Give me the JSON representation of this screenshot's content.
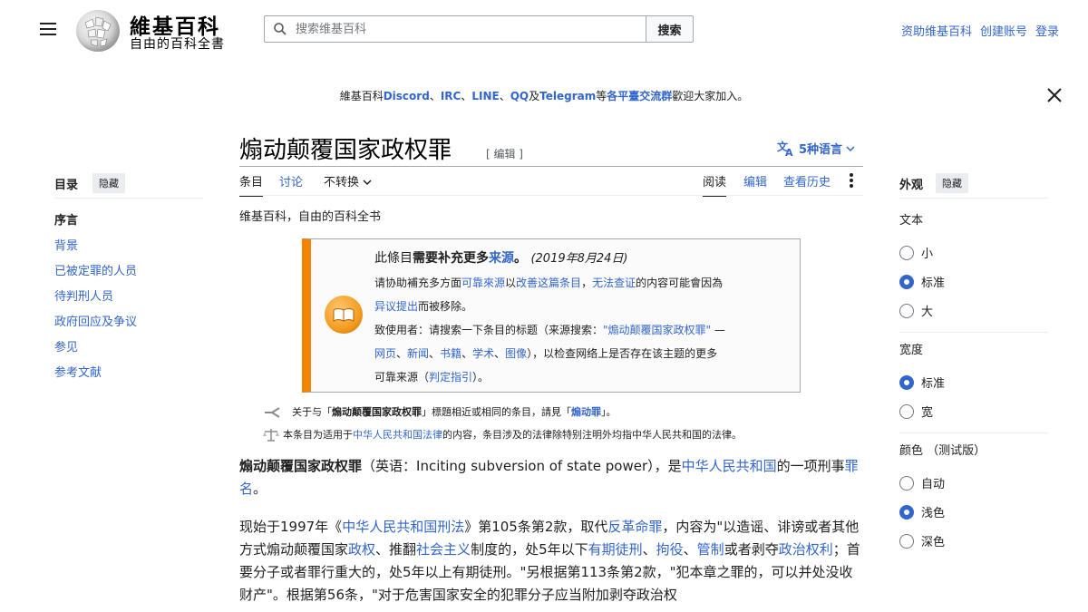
{
  "header": {
    "site_name": "維基百科",
    "tagline": "自由的百科全書",
    "search_placeholder": "搜索维基百科",
    "search_button": "搜索",
    "user_links": [
      "资助维基百科",
      "创建账号",
      "登录"
    ]
  },
  "notice": {
    "prefix": "維基百科",
    "discord": "Discord",
    "sep1": "、",
    "irc": "IRC",
    "sep2": "、",
    "line": "LINE",
    "sep3": "、",
    "qq": "QQ",
    "and": "及",
    "telegram": "Telegram",
    "mid": "等",
    "platforms": "各平臺交流群",
    "suffix": "歡迎大家加入。"
  },
  "article": {
    "title": "煽动颠覆国家政权罪",
    "edit_label": "[ 编辑 ]",
    "languages": "5种语言",
    "tabs_left": [
      "条目",
      "讨论",
      "不转换"
    ],
    "tabs_right": [
      "阅读",
      "编辑",
      "查看历史"
    ],
    "from": "维基百科，自由的百科全书"
  },
  "toc": {
    "heading": "目录",
    "hide": "隐藏",
    "items": [
      "序言",
      "背景",
      "已被定罪的人员",
      "待判刑人员",
      "政府回应及争议",
      "参见",
      "参考文献"
    ]
  },
  "ambox": {
    "l1a": "此條目",
    "l1b": "需要补充更多",
    "l1c": "来源",
    "l1d": "。",
    "l1date": "(2019年8月24日)",
    "l2a": "请协助補充多方面",
    "l2b": "可靠來源",
    "l2c": "以",
    "l2d": "改善这篇条目",
    "l2e": "，",
    "l2f": "无法查证",
    "l2g": "的内容可能會因為",
    "l3a": "异议提出",
    "l3b": "而被移除。",
    "l4a": "致使用者：请搜索一下条目的标题（来源搜索：",
    "l4b": "\"煽动颠覆国家政权罪\"",
    "l4c": " —",
    "l5links": [
      "网页",
      "新闻",
      "书籍",
      "学术",
      "图像"
    ],
    "l5sep": "、",
    "l5b": "），以检查网络上是否存在该主题的更多",
    "l6a": "可靠来源（",
    "l6b": "判定指引",
    "l6c": "）。"
  },
  "hatnotes": {
    "h1a": "关于与「",
    "h1b": "煽动颠覆国家政权罪",
    "h1c": "」標題相近或相同的条目，請見「",
    "h1d": "煽动罪",
    "h1e": "」。",
    "h2a": "本条目为适用于",
    "h2b": "中华人民共和国法律",
    "h2c": "的内容，条目涉及的法律除特别注明外均指中华人民共和国的法律。"
  },
  "lead": {
    "bold": "煽动颠覆国家政权罪",
    "p1": "（英语：Inciting subversion of state power），是",
    "prc": "中华人民共和国",
    "p2": "的一项刑事",
    "crime": "罪名",
    "p3": "。"
  },
  "para2": {
    "a": "现始于1997年《",
    "law": "中华人民共和国刑法",
    "b": "》第105条第2款，取代",
    "counter": "反革命罪",
    "c": "，内容为\"以造谣、诽谤或者其他方式煽动颠覆国家",
    "power": "政权",
    "d": "、推翻",
    "soc": "社会主义",
    "e": "制度的，处5年以下",
    "fixed": "有期徒刑",
    "f": "、",
    "det": "拘役",
    "g": "、",
    "ctrl": "管制",
    "h": "或者剥夺",
    "pol": "政治权利",
    "i": "；首要分子或者罪行重大的，处5年以上有期徒刑。\"另根据第113条第2款，\"犯本章之罪的，可以并处没收财产\"。根据第56条，\"对于危害国家安全的犯罪分子应当附加剥夺政治权"
  },
  "appearance": {
    "heading": "外观",
    "hide": "隐藏",
    "text_label": "文本",
    "text_options": [
      "小",
      "标准",
      "大"
    ],
    "text_selected": 1,
    "width_label": "宽度",
    "width_options": [
      "标准",
      "宽"
    ],
    "width_selected": 0,
    "color_label": "颜色 （测试版）",
    "color_options": [
      "自动",
      "浅色",
      "深色"
    ],
    "color_selected": 1
  },
  "colors": {
    "link": "#3366cc",
    "ambox_stripe": "#f28500",
    "radio_selected": "#3366cc"
  }
}
